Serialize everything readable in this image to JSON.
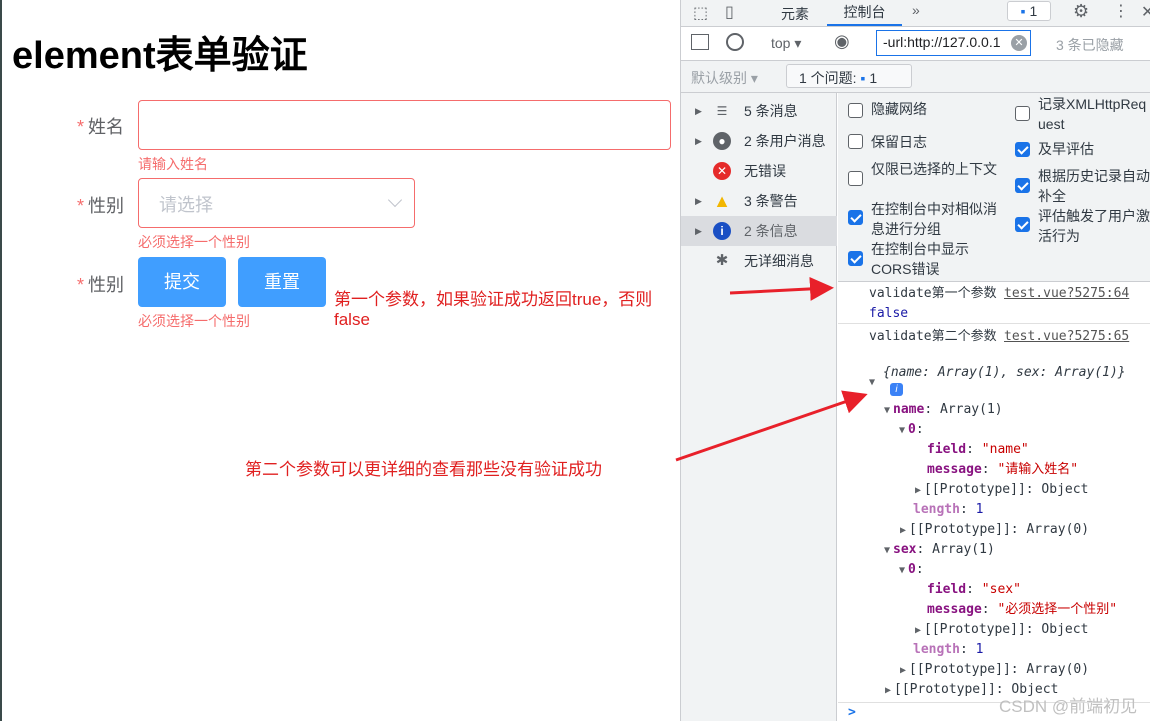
{
  "page": {
    "title": "element表单验证",
    "form": {
      "name_label": "姓名",
      "name_error": "请输入姓名",
      "sex_label": "性别",
      "sex_placeholder": "请选择",
      "sex_error": "必须选择一个性别",
      "third_label": "性别",
      "third_error": "必须选择一个性别",
      "submit": "提交",
      "reset": "重置",
      "required_mark": "*"
    },
    "annotations": {
      "first": "第一个参数，如果验证成功返回true，否则false",
      "second": "第二个参数可以更详细的查看那些没有验证成功",
      "arrow_color": "#e8202a"
    }
  },
  "devtools": {
    "tabs": [
      "元素",
      "控制台"
    ],
    "active_tab": "控制台",
    "more": "»",
    "issues_badge": "1",
    "context": "top",
    "filter_value": "-url:http://127.0.0.1",
    "hidden": "3 条已隐藏",
    "level": "默认级别",
    "issues_label": "1 个问题:",
    "issues_count": "1",
    "sidebar": [
      {
        "label": "5 条消息",
        "icon": "list-icon"
      },
      {
        "label": "2 条用户消息",
        "icon": "user-icon"
      },
      {
        "label": "无错误",
        "icon": "error-icon"
      },
      {
        "label": "3 条警告",
        "icon": "warning-icon"
      },
      {
        "label": "2 条信息",
        "icon": "info-icon",
        "selected": true
      },
      {
        "label": "无详细消息",
        "icon": "bug-icon"
      }
    ],
    "settings_left": [
      {
        "label": "隐藏网络",
        "checked": false
      },
      {
        "label": "保留日志",
        "checked": false
      },
      {
        "label": "仅限已选择的上下文",
        "checked": false
      },
      {
        "label": "在控制台中对相似消息进行分组",
        "checked": true
      },
      {
        "label": "在控制台中显示CORS错误",
        "checked": true
      }
    ],
    "settings_right": [
      {
        "label": "记录XMLHttpRequest",
        "checked": false
      },
      {
        "label": "及早评估",
        "checked": true
      },
      {
        "label": "根据历史记录自动补全",
        "checked": true
      },
      {
        "label": "评估触发了用户激活行为",
        "checked": true
      }
    ],
    "console": {
      "msg1": {
        "text": "validate第一个参数",
        "value": "false",
        "source": "test.vue?5275:64"
      },
      "msg2": {
        "text": "validate第二个参数",
        "source": "test.vue?5275:65",
        "summary": "{name: Array(1), sex: Array(1)}"
      },
      "tree": {
        "name_key": "name",
        "array1": "Array(1)",
        "idx": "0",
        "field_key": "field",
        "field_name": "\"name\"",
        "message_key": "message",
        "message_name": "\"请输入姓名\"",
        "proto_obj": "[[Prototype]]: Object",
        "length_key": "length",
        "length_val": "1",
        "proto_arr": "[[Prototype]]: Array(0)",
        "sex_key": "sex",
        "field_sex": "\"sex\"",
        "message_sex": "\"必须选择一个性别\""
      },
      "prompt": ">"
    },
    "watermark": "CSDN @前端初见"
  }
}
